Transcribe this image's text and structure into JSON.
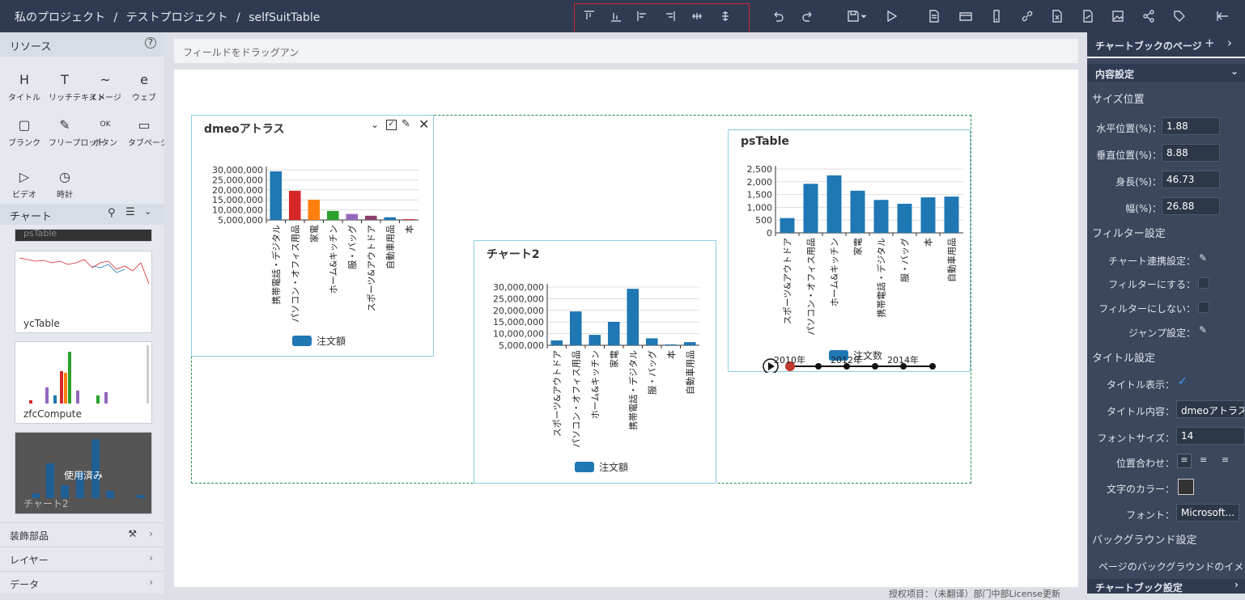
{
  "breadcrumb": {
    "root": "私のプロジェクト",
    "sep": "/",
    "project": "テストプロジェクト",
    "page": "selfSuitTable"
  },
  "left": {
    "resources_title": "リソース",
    "resources": [
      {
        "icon": "H",
        "label": "タイトル"
      },
      {
        "icon": "T",
        "label": "リッチテキスト"
      },
      {
        "icon": "~",
        "label": "イメージ"
      },
      {
        "icon": "e",
        "label": "ウェブ"
      },
      {
        "icon": "▢",
        "label": "ブランク"
      },
      {
        "icon": "✎",
        "label": "フリープロット"
      },
      {
        "icon": "OK",
        "label": "ボタン"
      },
      {
        "icon": "▭",
        "label": "タブページ"
      },
      {
        "icon": "▷",
        "label": "ビデオ"
      },
      {
        "icon": "◷",
        "label": "時計"
      }
    ],
    "chart_title": "チャート",
    "thumbs": [
      "psTable",
      "ycTable",
      "zfcCompute",
      "チャート2"
    ],
    "used_label": "使用済み",
    "sections": [
      "装飾部品",
      "レイヤー",
      "データ"
    ]
  },
  "center": {
    "drop_placeholder": "フィールドをドラッグアン",
    "footnote": "授权项目：（未翻译）部门中部License更新"
  },
  "charts": [
    {
      "title": "dmeoアトラス",
      "legend": "注文額",
      "color": "#1f77b4",
      "categories": [
        "携帯電話・デジタル",
        "パソコン・オフィス用品",
        "家電",
        "ホーム&キッチン",
        "服・バッグ",
        "スポーツ&アウトドア",
        "自動車用品",
        "本"
      ],
      "values": [
        32500000,
        19500000,
        13500000,
        6000000,
        4000000,
        2800000,
        1800000,
        500000
      ],
      "bar_colors": [
        "#1f77b4",
        "#d62728",
        "#ff7f0e",
        "#2ca02c",
        "#9467bd",
        "#8c3e6e",
        "#1f77b4",
        "#d62728"
      ],
      "ticks": [
        "30,000,000",
        "25,000,000",
        "20,000,000",
        "15,000,000",
        "10,000,000",
        "5,000,000"
      ]
    },
    {
      "title": "チャート2",
      "legend": "注文額",
      "color": "#1f77b4",
      "categories": [
        "スポーツ&アウトドア",
        "パソコン・オフィス用品",
        "ホーム&キッチン",
        "家電",
        "携帯電話・デジタル",
        "服・バッグ",
        "本",
        "自動車用品"
      ],
      "values": [
        2800000,
        19500000,
        6000000,
        13500000,
        32500000,
        4000000,
        500000,
        1800000
      ],
      "ticks": [
        "30,000,000",
        "25,000,000",
        "20,000,000",
        "15,000,000",
        "10,000,000",
        "5,000,000"
      ]
    },
    {
      "title": "psTable",
      "legend": "注文数",
      "color": "#1f77b4",
      "categories": [
        "スポーツ&アウトドア",
        "パソコン・オフィス用品",
        "ホーム&キッチン",
        "家電",
        "携帯電話・デジタル",
        "服・バッグ",
        "本",
        "自動車用品"
      ],
      "values": [
        580,
        1920,
        2250,
        1650,
        1290,
        1140,
        1390,
        1420
      ],
      "ticks": [
        "2,500",
        "2,000",
        "1,500",
        "1,000",
        "500",
        "0"
      ],
      "timeline": [
        "2010年",
        "2012年",
        "2014年"
      ]
    }
  ],
  "right": {
    "page_tab": "チャートブックのページ",
    "content_settings": "内容設定",
    "size_position": "サイズ位置",
    "h_pos_label": "水平位置(%)：",
    "h_pos": "1.88",
    "v_pos_label": "垂直位置(%)：",
    "v_pos": "8.88",
    "height_label": "身長(%)：",
    "height": "46.73",
    "width_label": "幅(%)：",
    "width": "26.88",
    "filter_settings": "フィルター設定",
    "link_label": "チャート連携設定：",
    "as_filter_label": "フィルターにする：",
    "no_filter_label": "フィルターにしない：",
    "jump_label": "ジャンプ設定：",
    "title_settings": "タイトル設定",
    "title_show_label": "タイトル表示：",
    "title_content_label": "タイトル内容：",
    "title_content": "dmeoアトラス",
    "font_size_label": "フォントサイズ：",
    "font_size": "14",
    "align_label": "位置合わせ：",
    "text_color_label": "文字のカラー：",
    "text_color": "#333333",
    "font_label": "フォント：",
    "font": "Microsoft...",
    "bg_settings": "バックグラウンド設定",
    "page_bg": "ページのバックグラウンドのイメ",
    "book_settings": "チャートブック設定"
  }
}
